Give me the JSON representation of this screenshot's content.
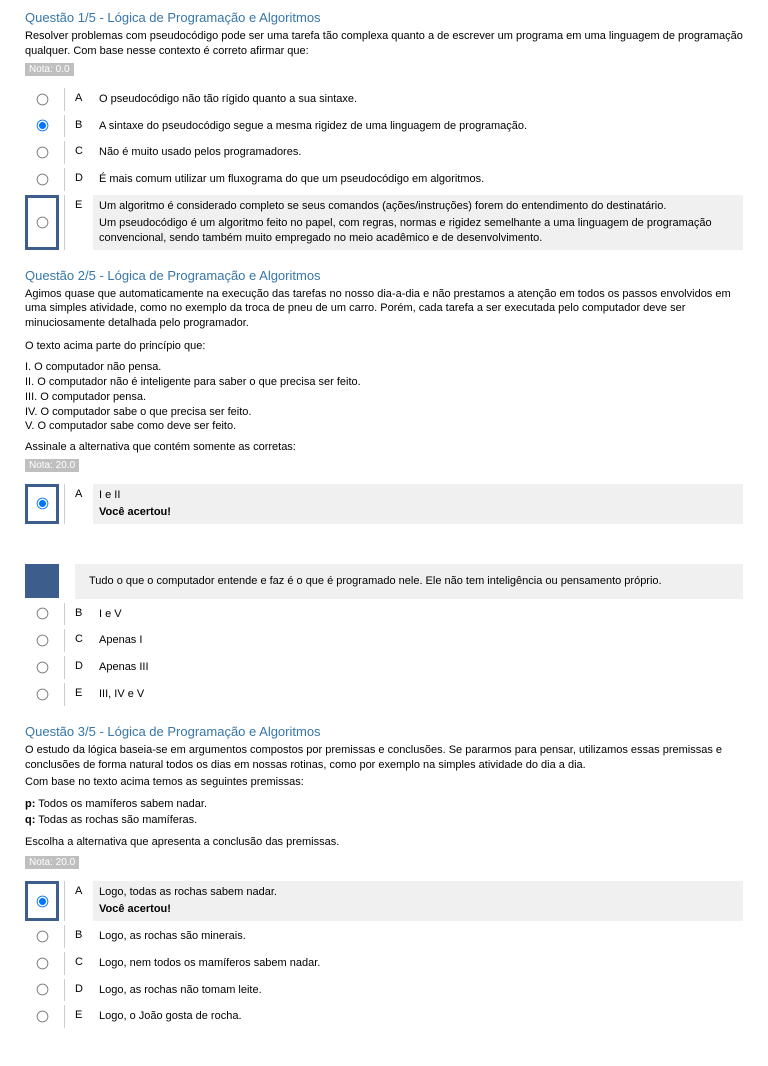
{
  "q1": {
    "title": "Questão 1/5 - Lógica de Programação e Algoritmos",
    "intro": "Resolver problemas com pseudocódigo pode ser uma tarefa tão complexa quanto a de escrever um programa em uma linguagem de programação qualquer. Com base nesse contexto é correto afirmar que:",
    "nota": "Nota: 0.0",
    "opts": {
      "A": "O pseudocódigo não tão rígido quanto a sua sintaxe.",
      "B": "A sintaxe do pseudocódigo segue a mesma rigidez de uma linguagem de programação.",
      "C": "Não é muito usado pelos programadores.",
      "D": "É mais comum utilizar um fluxograma do que um pseudocódigo em algoritmos.",
      "E": "Um algoritmo é considerado completo se seus comandos (ações/instruções) forem do entendimento do destinatário.",
      "E_feedback": "Um pseudocódigo é um algoritmo feito no papel, com regras, normas e rigidez semelhante a uma linguagem de programação convencional, sendo também muito empregado no meio acadêmico e de desenvolvimento."
    }
  },
  "q2": {
    "title": "Questão 2/5 - Lógica de Programação e Algoritmos",
    "intro": "Agimos quase que automaticamente na execução das tarefas no nosso dia-a-dia e não prestamos a atenção em todos os passos envolvidos em uma simples atividade, como no exemplo da troca de pneu de um carro. Porém, cada tarefa a ser executada pelo computador deve ser minuciosamente detalhada pelo programador.",
    "principio": "O texto acima parte do princípio que:",
    "stems": {
      "s1": "I. O computador não pensa.",
      "s2": "II. O computador não é inteligente para saber o que precisa ser feito.",
      "s3": "III. O computador pensa.",
      "s4": "IV. O computador sabe o que precisa ser feito.",
      "s5": "V. O computador sabe como deve ser feito."
    },
    "assinale": "Assinale a alternativa que contém somente as corretas:",
    "nota": "Nota: 20.0",
    "opts": {
      "A": "I e II",
      "A_feedback": "Você acertou!",
      "explain": "Tudo o que o computador entende e faz é o que é programado nele. Ele não tem inteligência ou pensamento próprio.",
      "B": "I e V",
      "C": "Apenas I",
      "D": "Apenas III",
      "E": "III, IV e V"
    }
  },
  "q3": {
    "title": "Questão 3/5 - Lógica de Programação e Algoritmos",
    "intro": "O estudo da lógica baseia-se em argumentos compostos por premissas e conclusões. Se pararmos para pensar, utilizamos essas premissas e conclusões de forma natural todos os dias em nossas rotinas, como por exemplo na simples atividade do dia a dia.",
    "com_base": "Com base no texto acima temos as seguintes premissas:",
    "p_label": "p:",
    "p_text": " Todos os mamíferos sabem nadar.",
    "q_label": "q:",
    "q_text": " Todas as rochas são mamíferas.",
    "escolha": "Escolha a alternativa que apresenta a conclusão das premissas.",
    "nota": "Nota: 20.0",
    "opts": {
      "A": "Logo, todas as rochas sabem nadar.",
      "A_feedback": "Você acertou!",
      "B": "Logo, as rochas são minerais.",
      "C": "Logo, nem todos os mamíferos sabem nadar.",
      "D": "Logo, as rochas não tomam leite.",
      "E": "Logo, o João gosta de rocha."
    }
  },
  "letters": {
    "A": "A",
    "B": "B",
    "C": "C",
    "D": "D",
    "E": "E"
  }
}
